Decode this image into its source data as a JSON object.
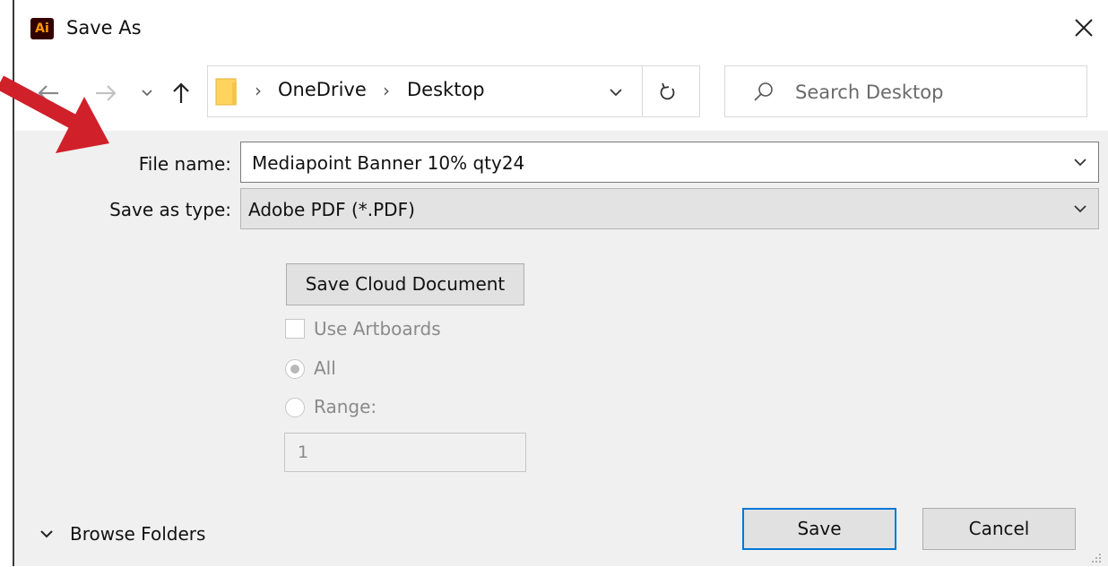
{
  "window": {
    "app_icon_text": "Ai",
    "title": "Save As",
    "close_icon": "close-icon"
  },
  "navigation": {
    "back_icon": "arrow-left-icon",
    "forward_icon": "arrow-right-icon",
    "recent_icon": "chevron-down-icon",
    "up_icon": "arrow-up-icon"
  },
  "address": {
    "folder_icon": "folder-icon",
    "breadcrumbs": [
      "OneDrive",
      "Desktop"
    ],
    "separator": "›",
    "dropdown_icon": "chevron-down-icon",
    "refresh_icon": "refresh-icon"
  },
  "search": {
    "placeholder": "Search Desktop",
    "value": "",
    "icon": "search-icon"
  },
  "form": {
    "file_name_label": "File name:",
    "file_name_value": "Mediapoint Banner 10% qty24",
    "save_type_label": "Save as type:",
    "save_type_value": "Adobe PDF (*.PDF)"
  },
  "options": {
    "cloud_button": "Save Cloud Document",
    "use_artboards_label": "Use Artboards",
    "use_artboards_checked": false,
    "all_label": "All",
    "all_selected": true,
    "range_label": "Range:",
    "range_value": "1"
  },
  "footer": {
    "browse_folders_label": "Browse Folders",
    "save_button": "Save",
    "cancel_button": "Cancel"
  },
  "colors": {
    "annotation_arrow": "#d0202a",
    "default_button_border": "#0078d7",
    "panel_background": "#f0f0f0",
    "app_icon_background": "#330000",
    "app_icon_text": "#ff9a00"
  }
}
